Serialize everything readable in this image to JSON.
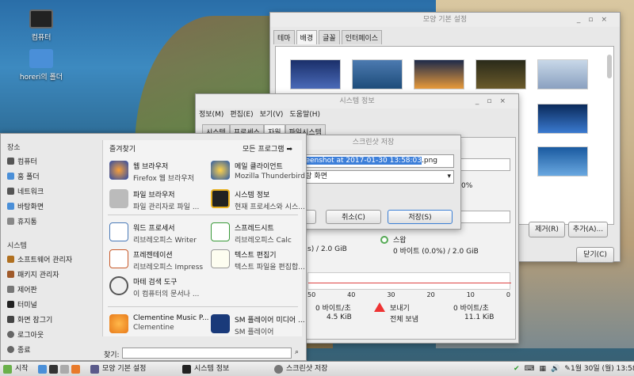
{
  "desktop": {
    "icons": [
      {
        "label": "컴퓨터",
        "icon": "computer-icon"
      },
      {
        "label": "horeri의 폴더",
        "icon": "home-folder-icon"
      }
    ]
  },
  "settings_window": {
    "title": "모양 기본 설정",
    "tabs": [
      "테마",
      "배경",
      "글꼴",
      "인터페이스"
    ],
    "active_tab": "배경",
    "remove_button": "제거(R)",
    "add_button": "추가(A)...",
    "close_button": "닫기(C)"
  },
  "sysinfo_window": {
    "title": "시스템 정보",
    "menu": [
      "정보(M)",
      "편집(E)",
      "보기(V)",
      "도움말(H)"
    ],
    "tabs": [
      "시스템",
      "프로세스",
      "자원",
      "파일시스템"
    ],
    "pct": "0%",
    "memory_line": "s) / 2.0 GiB",
    "swap_label": "스왑",
    "swap_value": "0 바이트 (0.0%) / 2.0 GiB",
    "axis_ticks": [
      "50",
      "40",
      "30",
      "20",
      "10",
      "0"
    ],
    "recv_rate": "0 바이트/초",
    "recv_total": "4.5 KiB",
    "send_label": "보내기",
    "send_rate": "0 바이트/초",
    "send_total_label": "전체 보냄",
    "send_total": "11.1 KiB"
  },
  "save_dialog": {
    "title": "스크린샷 저장",
    "filename": "Screenshot at 2017-01-30 13:58:03.png",
    "filename_selected": "creenshot at 2017-01-30 13:58:03",
    "filename_ext": ".png",
    "folder": "바탕 화면",
    "cancel": "취소(C)",
    "save": "저장(S)"
  },
  "start_menu": {
    "places_heading": "장소",
    "places": [
      "컴퓨터",
      "홈 폴더",
      "네트워크",
      "바탕화면",
      "휴지통"
    ],
    "system_heading": "시스템",
    "system": [
      "소프트웨어 관리자",
      "패키지 관리자",
      "제어판",
      "터미널",
      "화면 잠그기",
      "로그아웃",
      "종료"
    ],
    "favorites_heading": "즐겨찾기",
    "all_programs": "모든 프로그램",
    "apps": [
      {
        "name": "웹 브라우저",
        "desc": "Firefox 웹 브라우저"
      },
      {
        "name": "메일 클라이언트",
        "desc": "Mozilla Thunderbird"
      },
      {
        "name": "파일 브라우저",
        "desc": "파일 관리자로 파일 ..."
      },
      {
        "name": "시스템 정보",
        "desc": "현재 프로세스와 시스..."
      },
      {
        "name": "워드 프로세서",
        "desc": "리브레오피스 Writer"
      },
      {
        "name": "스프레드시트",
        "desc": "리브레오피스 Calc"
      },
      {
        "name": "프레젠테이션",
        "desc": "리브레오피스 Impress"
      },
      {
        "name": "텍스트 편집기",
        "desc": "텍스트 파일을 편집합..."
      },
      {
        "name": "마테 검색 도구",
        "desc": "이 컴퓨터의 문서나 ..."
      },
      {
        "name": "Clementine Music P...",
        "desc": "Clementine"
      },
      {
        "name": "SM 플레이어 미디어 ...",
        "desc": "SM 플레이어"
      }
    ],
    "search_label": "찾기:"
  },
  "taskbar": {
    "start": "시작",
    "tasks": [
      "모양 기본 설정",
      "시스템 정보",
      "스크린샷 저장"
    ],
    "clock": "1월 30일 (월) 13:58"
  },
  "colors": {
    "accent": "#3b7fd4",
    "selection": "#3d7fd9"
  }
}
